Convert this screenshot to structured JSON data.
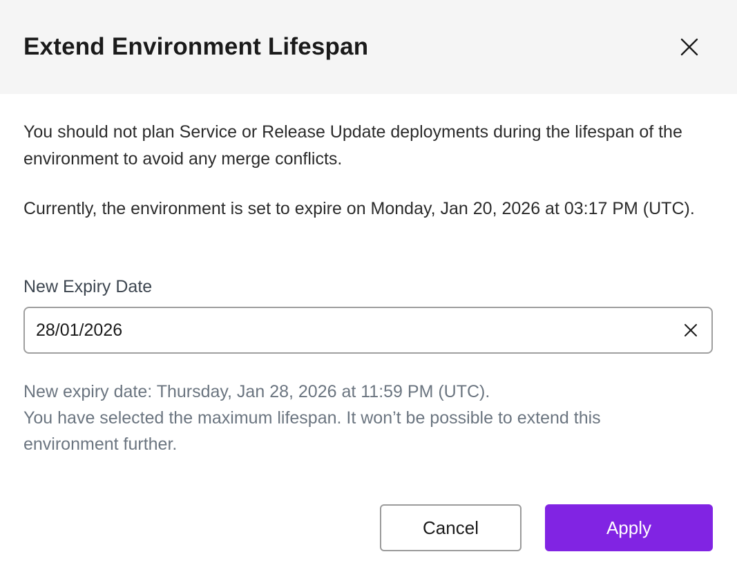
{
  "dialog": {
    "title": "Extend Environment Lifespan",
    "close_icon": "close-icon",
    "intro_text": "You should not plan Service or Release Update deployments during the lifespan of the environment to avoid any merge conflicts.",
    "current_expiry_text": "Currently, the environment is set to expire on Monday, Jan 20, 2026 at 03:17 PM (UTC).",
    "field": {
      "label": "New Expiry Date",
      "value": "28/01/2026",
      "clear_icon": "clear-icon"
    },
    "helper": {
      "new_expiry_text": "New expiry date: Thursday, Jan 28, 2026 at 11:59 PM (UTC).",
      "max_lifespan_text": "You have selected the maximum lifespan. It won’t be possible to extend this environment further."
    },
    "buttons": {
      "cancel_label": "Cancel",
      "apply_label": "Apply"
    }
  },
  "colors": {
    "header_bg": "#f5f5f5",
    "primary_accent": "#8124e3",
    "helper_text": "#6b7580",
    "input_border": "#9e9e9e"
  }
}
